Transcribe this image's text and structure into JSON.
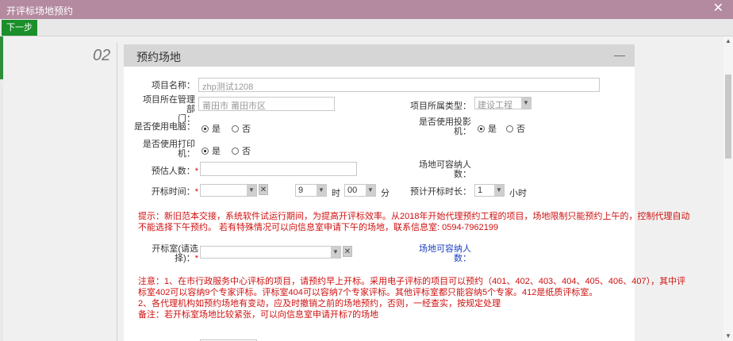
{
  "window": {
    "title": "开评标场地预约",
    "close_symbol": "✕"
  },
  "toolbar": {
    "next_label": "下一步"
  },
  "step": {
    "number": "02",
    "title": "预约场地",
    "collapse_symbol": "—"
  },
  "form": {
    "project_name": {
      "label": "项目名称：",
      "value": "zhp测试1208"
    },
    "dept": {
      "label_line1": "项目所在管理部",
      "label_line2": "门：",
      "value": "莆田市 莆田市区"
    },
    "type": {
      "label": "项目所属类型：",
      "value": "建设工程"
    },
    "use_pc": {
      "label": "是否使用电脑：",
      "yes": "是",
      "no": "否"
    },
    "use_projector": {
      "label_line1": "是否使用投影",
      "label_line2": "机：",
      "yes": "是",
      "no": "否"
    },
    "use_printer": {
      "label_line1": "是否使用打印",
      "label_line2": "机：",
      "yes": "是",
      "no": "否"
    },
    "est_people": {
      "label": "预估人数：",
      "req": "*"
    },
    "capacity1": {
      "label_line1": "场地可容纳人",
      "label_line2": "数："
    },
    "open_time": {
      "label": "开标时间：",
      "req": "*",
      "hour": "9",
      "hour_unit": "时",
      "minute": "00",
      "minute_unit": "分"
    },
    "duration": {
      "label": "预计开标时长：",
      "value": "1",
      "unit": "小时"
    },
    "tip_line1": "提示：新旧范本交接，系统软件试运行期间，为提高开评标效率。从2018年开始代理预约工程的项目，场地限制只能预约上午的，控制代理自动",
    "tip_line2": "不能选择下午预约。 若有特殊情况可以向信息室申请下午的场地，联系信息室: 0594-7962199",
    "room": {
      "label_line1": "开标室(请选",
      "label_line2": "择)：",
      "req": "*"
    },
    "capacity2": {
      "label_line1": "场地可容纳人",
      "label_line2": "数："
    },
    "note_line1": "注意：1、在市行政服务中心评标的项目，请预约早上开标。采用电子评标的项目可以预约（401、402、403、404、405、406、407），其中评",
    "note_line2": "标室402可以容纳9个专家评标。评标室404可以容纳7个专家评标。其他评标室都只能容纳5个专家。412是纸质评标室。",
    "note_line3": "2、各代理机构如预约场地有变动，应及时撤销之前的场地预约，否则，一经查实，按规定处理",
    "note_line4": "备注：若开标室场地比较紧张，可以向信息室申请开标7的场地"
  },
  "colors": {
    "titlebar": "#b48aa0",
    "next_button": "#1a8f2a",
    "warning_text": "#d01010",
    "capacity_text": "#1a3fbf"
  }
}
